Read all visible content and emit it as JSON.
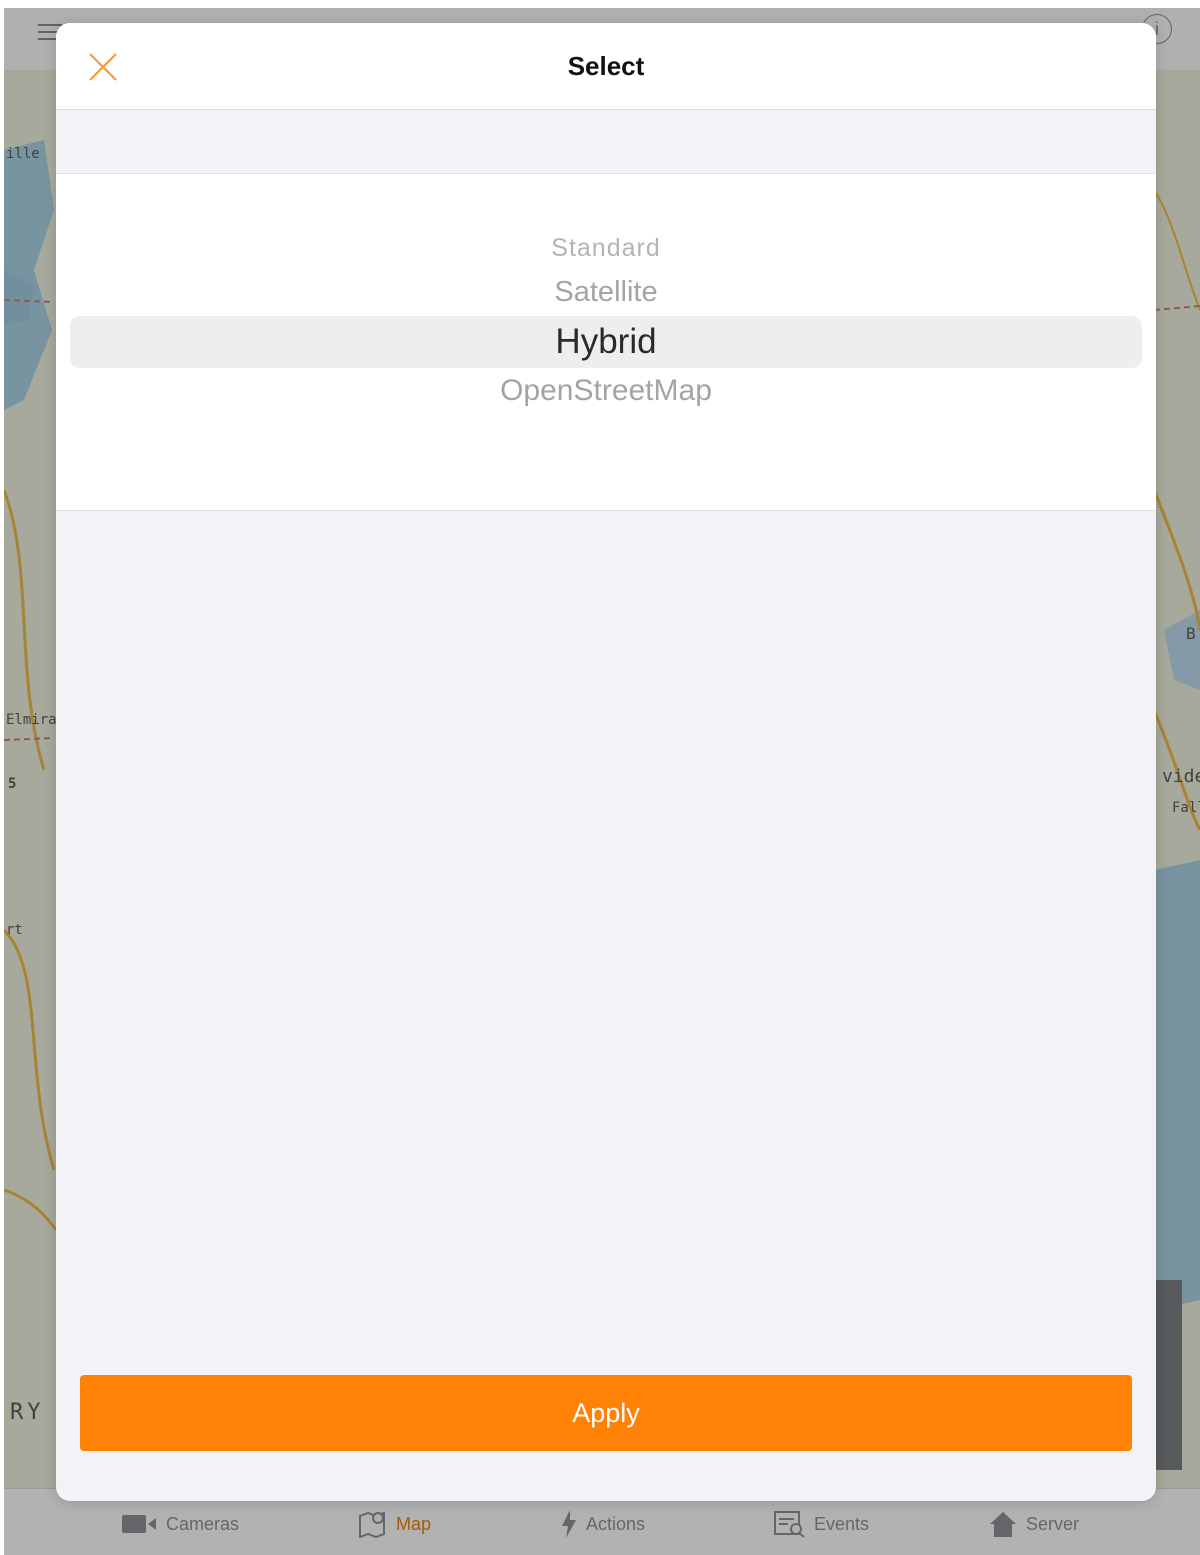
{
  "modal": {
    "title": "Select",
    "picker_options": [
      "Standard",
      "Satellite",
      "Hybrid",
      "OpenStreetMap"
    ],
    "selected": "Hybrid",
    "apply_label": "Apply"
  },
  "map_labels": {
    "l1": "ille",
    "l2": "Elmira",
    "l3": "5",
    "l4": "rt",
    "l5": "RY",
    "l6": "B",
    "l7": "viden",
    "l8": "Fall"
  },
  "tab_bar": {
    "tabs": [
      {
        "label": "Cameras",
        "icon": "camera-icon"
      },
      {
        "label": "Map",
        "icon": "map-icon"
      },
      {
        "label": "Actions",
        "icon": "bolt-icon"
      },
      {
        "label": "Events",
        "icon": "events-icon"
      },
      {
        "label": "Server",
        "icon": "home-icon"
      }
    ],
    "active": "Map"
  },
  "colors": {
    "accent": "#ff8207",
    "active_tab": "#e87d0d",
    "close_icon": "#f39a3d"
  }
}
